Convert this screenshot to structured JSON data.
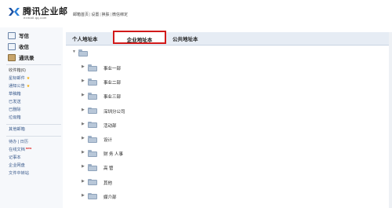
{
  "header": {
    "logo_text": "腾讯企业邮",
    "logo_sub": "exmail.qq.com",
    "links": [
      "邮箱首页",
      "设置",
      "换肤",
      "微信绑定"
    ]
  },
  "sidebar": {
    "main": [
      {
        "label": "写信",
        "icon": "pencil-icon"
      },
      {
        "label": "收信",
        "icon": "inbox-icon"
      },
      {
        "label": "通讯录",
        "icon": "contacts-icon"
      }
    ],
    "inbox_label": "收件箱(6)",
    "folders": [
      {
        "label": "星标邮件",
        "star": true
      },
      {
        "label": "通知公告",
        "star": true
      },
      {
        "label": "草稿箱"
      },
      {
        "label": "已发送"
      },
      {
        "label": "已删除"
      },
      {
        "label": "垃圾箱"
      }
    ],
    "other_mail": "其他邮箱",
    "tools": [
      {
        "label": "待办 | 日历"
      },
      {
        "label": "在线文档",
        "badge": "new"
      },
      {
        "label": "记事本"
      },
      {
        "label": "企业网盘"
      },
      {
        "label": "文件中转站"
      }
    ]
  },
  "tabs": {
    "personal": "个人地址本",
    "enterprise": "企业地址本",
    "public": "公共地址本",
    "active": "企业地址本"
  },
  "tree": {
    "root_icon": "folder-icon",
    "departments": [
      "事业一部",
      "事业二部",
      "事业三部",
      "深圳分公司",
      "活动部",
      "设计",
      "财 务 人事",
      "高 管",
      "其他",
      "媒介部"
    ]
  },
  "colors": {
    "accent_red": "#d21a1a",
    "link_blue": "#3a5a8c",
    "tab_bg": "#e6ecf4",
    "sidebar_bg": "#f6f8fb"
  }
}
